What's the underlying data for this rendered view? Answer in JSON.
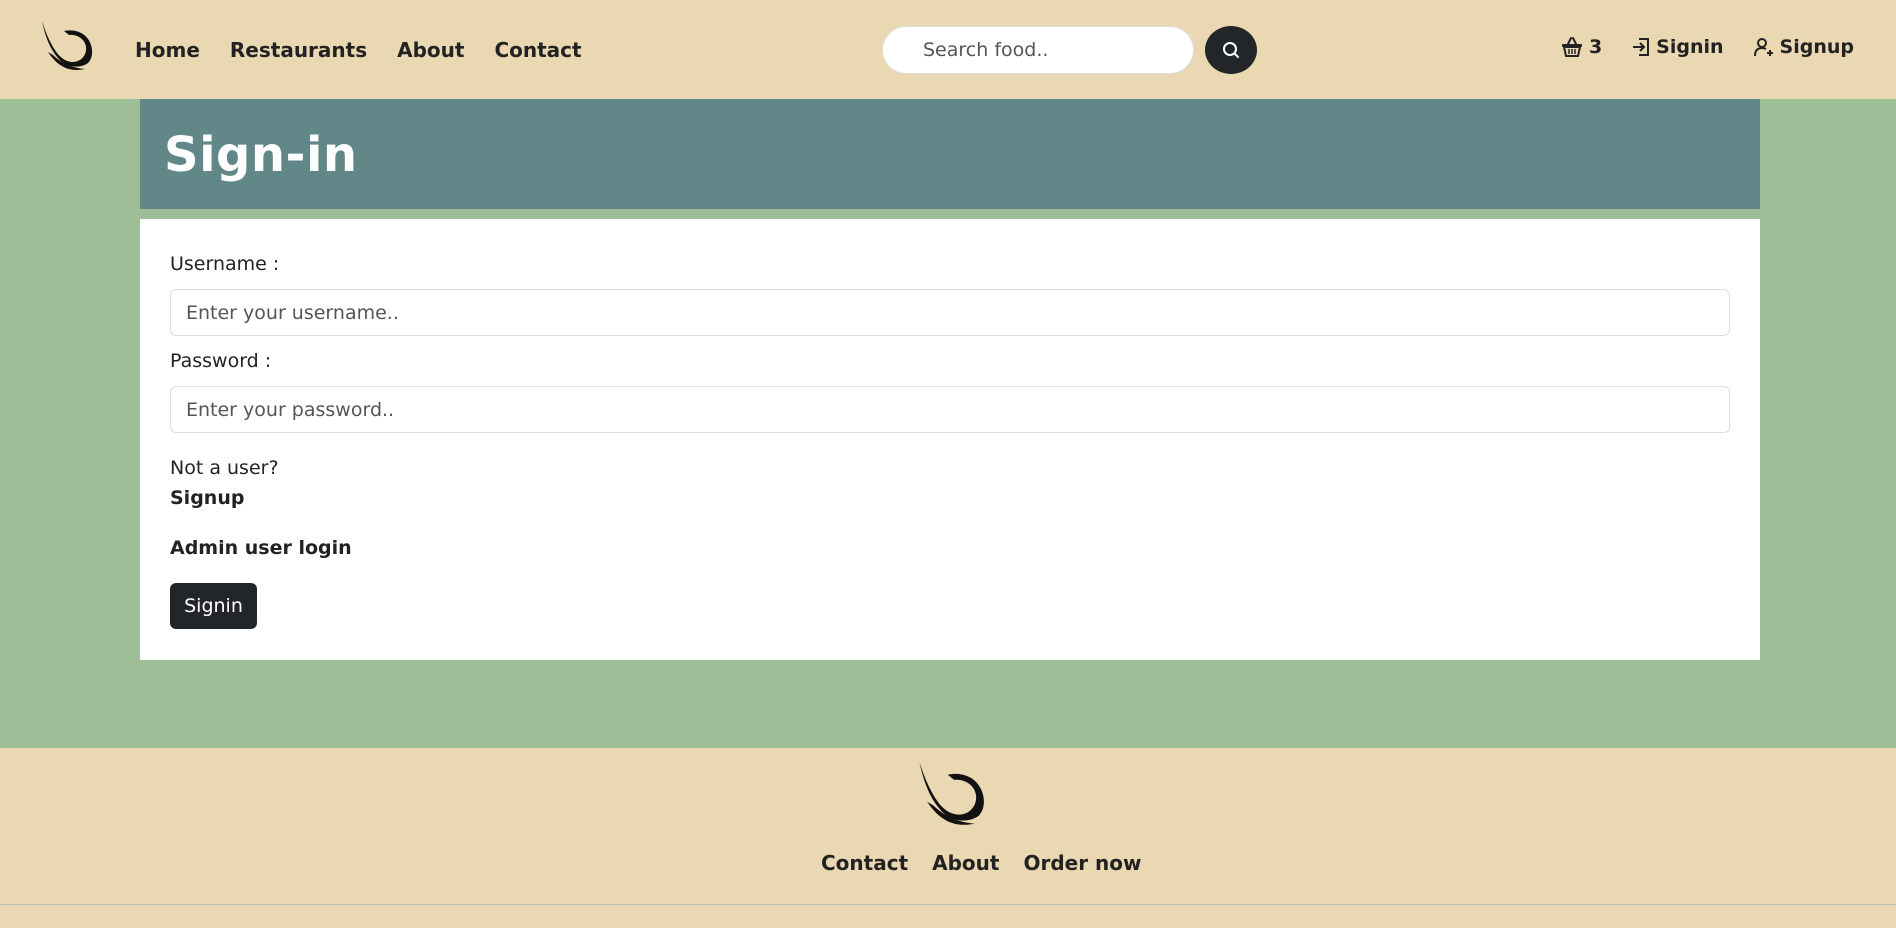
{
  "header": {
    "logo": "dove-wing-logo",
    "nav": [
      "Home",
      "Restaurants",
      "About",
      "Contact"
    ],
    "search": {
      "placeholder": "Search food.."
    },
    "cart_count": "3",
    "signin_label": "Signin",
    "signup_label": "Signup"
  },
  "page": {
    "title": "Sign-in"
  },
  "form": {
    "username_label": "Username :",
    "username_placeholder": "Enter your username..",
    "password_label": "Password :",
    "password_placeholder": "Enter your password..",
    "not_user_text": "Not a user?",
    "signup_link": "Signup",
    "admin_link": "Admin user login",
    "submit_label": "Signin"
  },
  "footer": {
    "nav": [
      "Contact",
      "About",
      "Order now"
    ]
  },
  "colors": {
    "topbar": "#ead8b2",
    "page_background": "#9ebe98",
    "header_band": "#618789",
    "dark_button": "#222629"
  }
}
